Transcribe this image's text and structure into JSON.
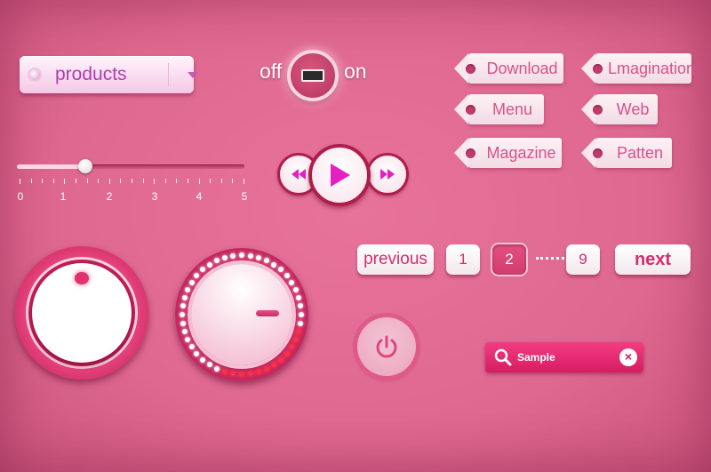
{
  "dropdown": {
    "selected": "products"
  },
  "toggle": {
    "off_label": "off",
    "on_label": "on",
    "state": "off"
  },
  "slider": {
    "value": 1.5,
    "min": 0,
    "max": 5,
    "labels": [
      "0",
      "1",
      "2",
      "3",
      "4",
      "5"
    ]
  },
  "media": {
    "prev_icon": "rewind-icon",
    "play_icon": "play-icon",
    "next_icon": "fast-forward-icon"
  },
  "tags": {
    "download": "Download",
    "imagination": "Lmagination",
    "menu": "Menu",
    "web": "Web",
    "magazine": "Magazine",
    "patten": "Patten"
  },
  "pagination": {
    "previous": "previous",
    "next": "next",
    "pages": [
      "1",
      "2",
      "9"
    ],
    "current": "2"
  },
  "search": {
    "placeholder": "Sample"
  },
  "colors": {
    "background": "#e06a92",
    "accent": "#d81c62",
    "tag_text": "#d9508b",
    "media_icon": "#e61fc3"
  },
  "icons": [
    "search-icon",
    "close-icon",
    "power-icon",
    "play-icon",
    "rewind-icon",
    "fast-forward-icon",
    "caret-down-icon"
  ]
}
